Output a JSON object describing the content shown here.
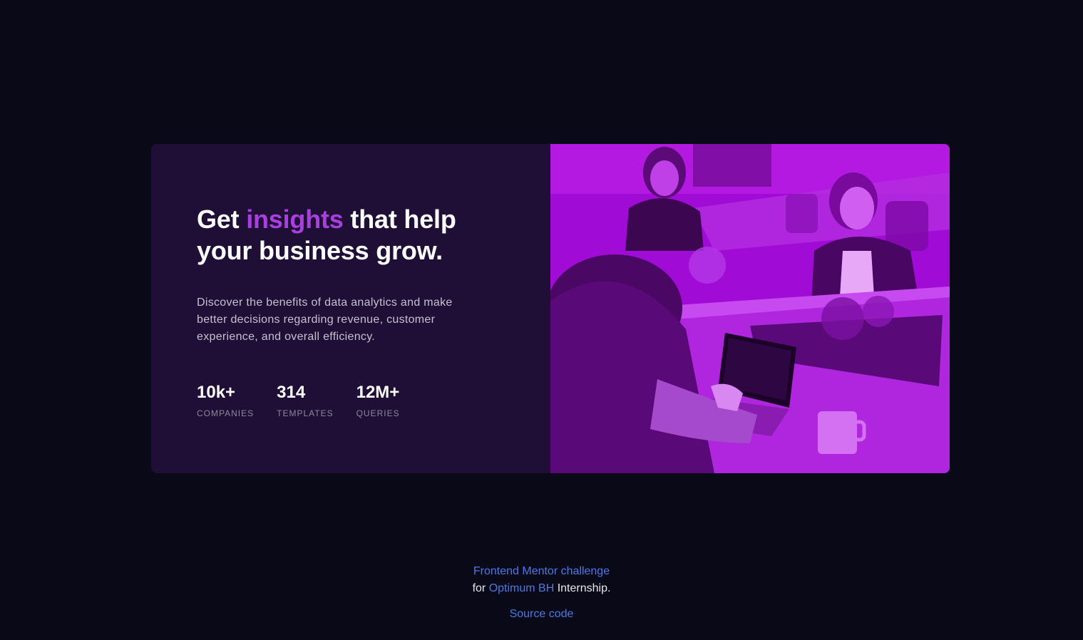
{
  "card": {
    "headline_pre": "Get ",
    "headline_accent": "insights",
    "headline_post": " that help your business grow.",
    "description": "Discover the benefits of data analytics and make better decisions regarding revenue, customer experience, and overall efficiency.",
    "stats": [
      {
        "value": "10k+",
        "label": "Companies"
      },
      {
        "value": "314",
        "label": "Templates"
      },
      {
        "value": "12M+",
        "label": "Queries"
      }
    ],
    "image_icon": "office-team-photo"
  },
  "footer": {
    "challenge_link": "Frontend Mentor challenge",
    "for_text": "for ",
    "org_link": "Optimum BH",
    "suffix_text": " Internship.",
    "source_link": "Source code"
  },
  "colors": {
    "page_bg": "#090918",
    "card_bg": "#1f0f37",
    "accent": "#aa3ee0",
    "image_tint": "#a10bd6",
    "link": "#4b79e6"
  }
}
